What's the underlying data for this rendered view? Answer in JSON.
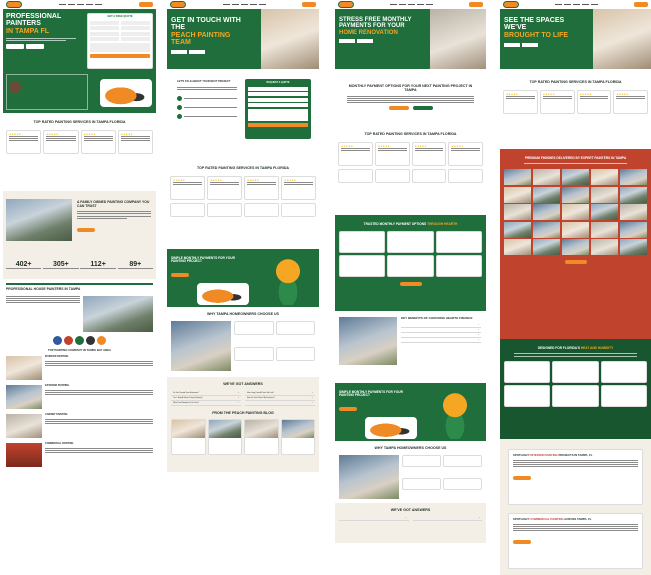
{
  "col1": {
    "hero": {
      "title_line1": "PROFESSIONAL PAINTERS",
      "title_accent": "IN TAMPA FL",
      "form_title": "GET A FREE QUOTE"
    },
    "reviews_heading": "TOP RATED PAINTING SERVICES IN TAMPA FLORIDA",
    "about_heading": "A FAMILY OWNED PAINTING COMPANY YOU CAN TRUST",
    "stats": [
      {
        "value": "402+"
      },
      {
        "value": "305+"
      },
      {
        "value": "112+"
      },
      {
        "value": "89+"
      }
    ],
    "services_heading": "PROFESSIONAL HOUSE PAINTERS IN TAMPA",
    "painting_heading": "Top Painting Company In Tampa Bay Area",
    "service_items": [
      {
        "label": "Interior Painting"
      },
      {
        "label": "Exterior Painting"
      },
      {
        "label": "Cabinet Painting"
      },
      {
        "label": "Commercial Painting"
      }
    ]
  },
  "col2": {
    "hero": {
      "title_line1": "GET IN TOUCH WITH THE",
      "title_accent": "PEACH PAINTING TEAM"
    },
    "contact_heading": "LET'S TALK ABOUT YOUR NEXT PROJECT",
    "form_title": "REQUEST A QUOTE",
    "reviews_heading": "TOP RATED PAINTING SERVICES IN TAMPA FLORIDA",
    "payments_heading": "SIMPLE MONTHLY PAYMENTS FOR YOUR PAINTING PROJECT",
    "why_heading": "WHY TAMPA HOMEOWNERS CHOOSE US",
    "faq_heading": "WE'VE GOT ANSWERS",
    "faq_items": [
      {
        "q": "Do You Provide Free Estimates?"
      },
      {
        "q": "How Long Does A Paint Job Last?"
      },
      {
        "q": "Can I Stay At Home During Painting?"
      },
      {
        "q": "How Do You Protect My Furniture?"
      },
      {
        "q": "What Paint Brands Do You Use?"
      }
    ],
    "blog_heading": "FROM THE PEACH PAINTING BLOG"
  },
  "col3": {
    "hero": {
      "title_line1": "STRESS FREE MONTHLY PAYMENTS FOR YOUR",
      "title_accent": "HOME RENOVATION"
    },
    "options_heading": "MONTHLY PAYMENT OPTIONS FOR YOUR NEXT PAINTING PROJECT IN TAMPA",
    "reviews_heading": "TOP RATED PAINTING SERVICES IN TAMPA FLORIDA",
    "trusted_heading": "TRUSTED MONTHLY PAYMENT OPTIONS",
    "trusted_accent": "THROUGH HEARTH",
    "benefits_heading": "KEY BENEFITS OF CHOOSING HEARTH FINANCE",
    "payments_heading": "SIMPLE MONTHLY PAYMENTS FOR YOUR PAINTING PROJECT",
    "why_heading": "WHY TAMPA HOMEOWNERS CHOOSE US",
    "faq_heading": "WE'VE GOT ANSWERS"
  },
  "col4": {
    "hero": {
      "title_line1": "SEE THE SPACES WE'VE",
      "title_accent": "BROUGHT TO LIFE"
    },
    "reviews_heading": "TOP RATED PAINTING SERVICES IN TAMPA FLORIDA",
    "gallery_heading": "PREMIUM FINISHES DELIVERED BY EXPERT PAINTERS IN TAMPA",
    "designed_heading": "DESIGNED FOR FLORIDA'S",
    "designed_accent": "HEAT AND HUMIDITY",
    "spotlight1_heading": "SPOTLIGHT:",
    "spotlight1_accent": "INTERIOR PAINTING",
    "spotlight1_tail": "PROJECTS IN TAMPA, FL",
    "spotlight2_heading": "SPOTLIGHT:",
    "spotlight2_accent": "COMMERCIAL PAINTING",
    "spotlight2_tail": "ACROSS TAMPA, FL"
  },
  "icons": {
    "logo": "peach-logo",
    "star": "★"
  },
  "colors": {
    "brand_green": "#1f6e3c",
    "brand_orange": "#f08a24",
    "accent_yellow": "#f5a623",
    "brand_red": "#c0432d",
    "cream": "#f4efe6"
  }
}
